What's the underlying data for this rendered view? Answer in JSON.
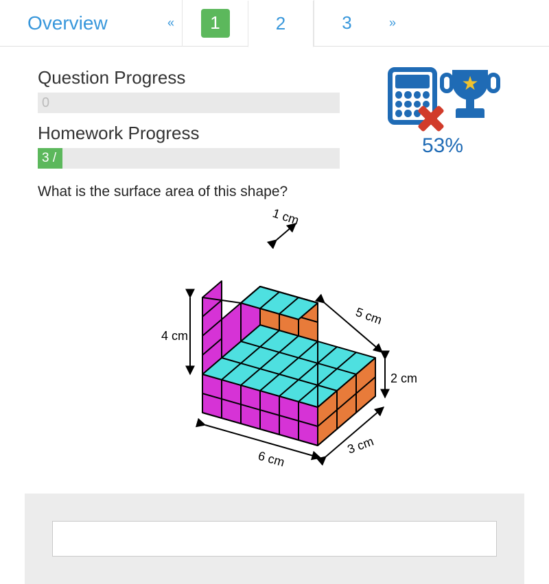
{
  "tabs": {
    "overview_label": "Overview",
    "prev_label": "«",
    "next_label": "»",
    "pages": [
      "1",
      "2",
      "3"
    ],
    "active_index": 0,
    "current_view_index": 1
  },
  "progress": {
    "question_label": "Question Progress",
    "question_value": "0",
    "homework_label": "Homework Progress",
    "homework_value": "3 /"
  },
  "award": {
    "percent": "53%"
  },
  "question": {
    "text": "What is the surface area of this shape?",
    "dims": {
      "top": "1 cm",
      "left": "4 cm",
      "right_top": "5 cm",
      "right_mid": "2 cm",
      "bottom_left": "6 cm",
      "bottom_right": "3 cm"
    }
  },
  "answer": {
    "value": ""
  },
  "icons": {
    "calculator": "calculator-icon",
    "trophy": "trophy-icon"
  },
  "colors": {
    "blue": "#1f6bb5",
    "green": "#5cb85c",
    "link": "#3897db",
    "magenta": "#d633d6",
    "cyan": "#4ee0e0",
    "orange": "#e87b3a"
  }
}
